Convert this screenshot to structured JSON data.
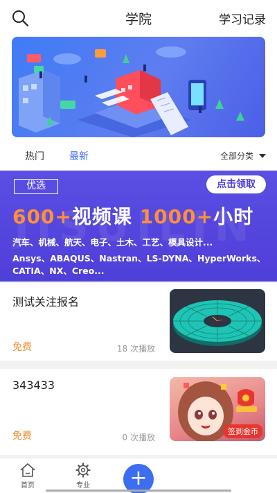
{
  "header": {
    "title": "学院",
    "records_label": "学习记录"
  },
  "tabs": {
    "hot": "热门",
    "latest": "最新",
    "category": "全部分类"
  },
  "promo": {
    "badge": "优选",
    "claim_button": "点击领取",
    "headline_num1": "600+",
    "headline_text1": "视频课",
    "headline_num2": "1000+",
    "headline_text2": "小时",
    "line1": "汽车、机械、航天、电子、土木、工艺、模具设计...",
    "line2": "Ansys、ABAQUS、Nastran、LS-DYNA、HyperWorks、",
    "line3": "CATIA、NX、Creo...",
    "watermark": "JISUILIN"
  },
  "courses": [
    {
      "title": "测试关注报名",
      "price": "免费",
      "plays": "18 次播放"
    },
    {
      "title": "343433",
      "price": "免费",
      "plays": "0 次播放",
      "thumb_badge": "签到金币"
    }
  ],
  "tabbar": {
    "home": "首页",
    "major": "专业",
    "add": "+"
  },
  "colors": {
    "accent": "#3d6ef0",
    "price": "#f58a2a",
    "promo_bg": "#5a4ee3"
  }
}
